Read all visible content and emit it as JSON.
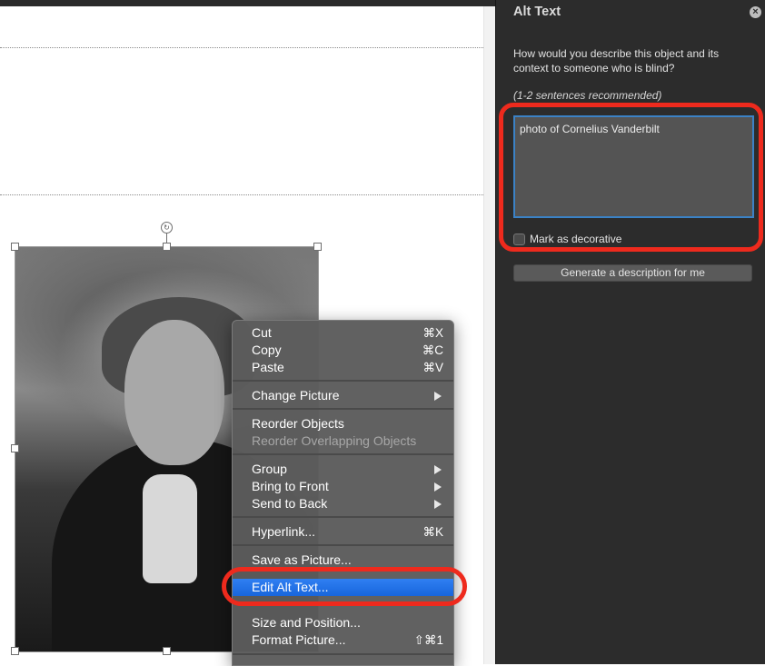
{
  "menu": {
    "items": [
      {
        "label": "Cut",
        "shortcut": "⌘X"
      },
      {
        "label": "Copy",
        "shortcut": "⌘C"
      },
      {
        "label": "Paste",
        "shortcut": "⌘V"
      },
      {
        "label": "Change Picture"
      },
      {
        "label": "Reorder Objects"
      },
      {
        "label": "Reorder Overlapping Objects"
      },
      {
        "label": "Group"
      },
      {
        "label": "Bring to Front"
      },
      {
        "label": "Send to Back"
      },
      {
        "label": "Hyperlink...",
        "shortcut": "⌘K"
      },
      {
        "label": "Save as Picture..."
      },
      {
        "label": "Edit Alt Text..."
      },
      {
        "label": "Size and Position..."
      },
      {
        "label": "Format Picture...",
        "shortcut": "⇧⌘1"
      }
    ]
  },
  "pane": {
    "title": "Alt Text",
    "question": "How would you describe this object and its context to someone who is blind?",
    "hint": "(1-2 sentences recommended)",
    "alt_text_value": "photo of Cornelius Vanderbilt",
    "decorative_label": "Mark as decorative",
    "decorative_checked": false,
    "generate_button": "Generate a description for me"
  },
  "colors": {
    "highlight": "#1a6ee6",
    "annotation_ring": "#ee2a1d",
    "pane_background": "#2c2c2c",
    "input_border": "#3b82c6"
  },
  "icons": {
    "close": "close-circle-icon",
    "rotate": "rotate-handle-icon",
    "submenu": "submenu-arrow-icon"
  }
}
